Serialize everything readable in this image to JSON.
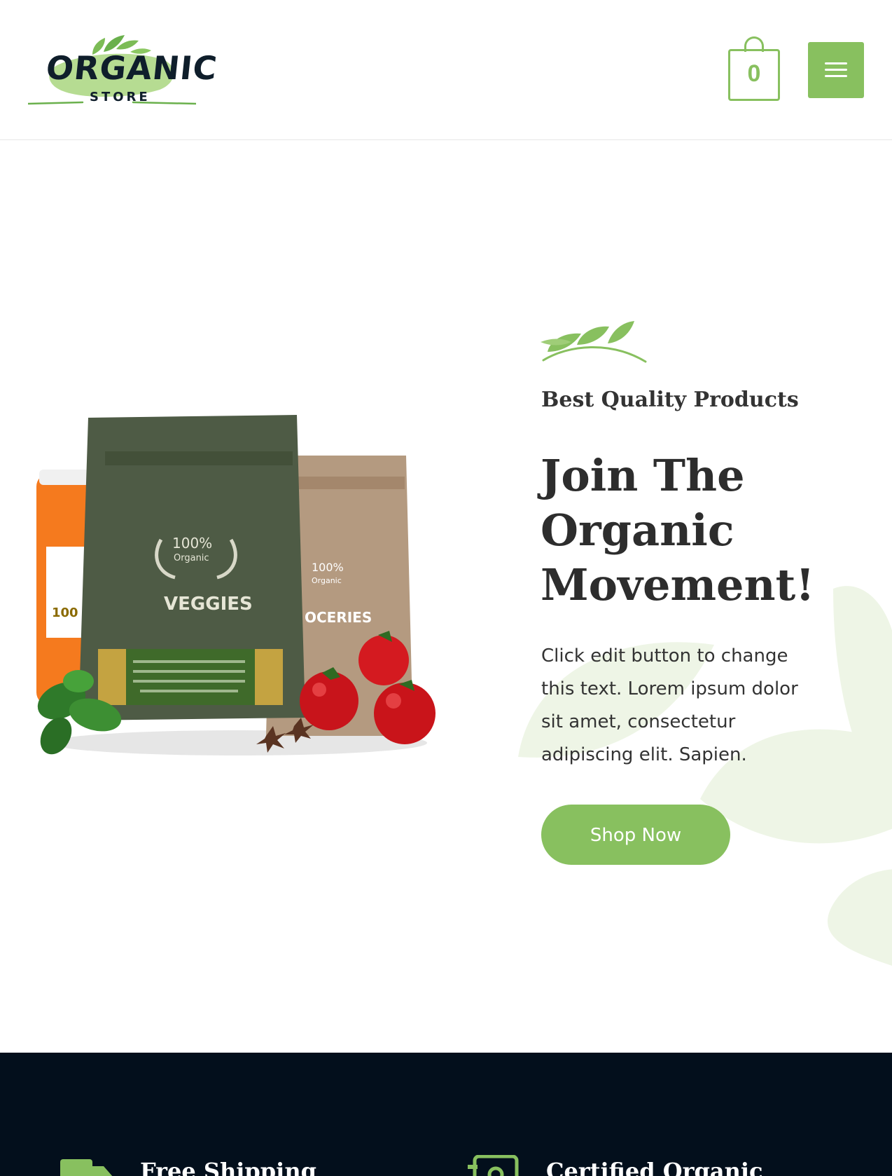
{
  "brand": {
    "logo_word": "ORGANIC",
    "logo_sub": "STORE"
  },
  "header": {
    "cart_count": "0"
  },
  "hero": {
    "eyebrow": "Best Quality Products",
    "title": "Join The Organic Movement!",
    "text": "Click edit button to change this text. Lorem ipsum dolor sit amet, consectetur adipiscing elit. Sapien.",
    "button_label": "Shop Now"
  },
  "products_image": {
    "bag_front_badge": "100%",
    "bag_front_badge_sub": "Organic",
    "bag_front_label": "VEGGIES",
    "bag_back_badge": "100%",
    "bag_back_badge_sub": "Organic",
    "bag_back_label": "OCERIES",
    "jar_label": "100"
  },
  "features": [
    {
      "title": "Free Shipping",
      "icon": "truck-icon"
    },
    {
      "title": "Certified Organic",
      "icon": "certificate-icon"
    }
  ],
  "colors": {
    "accent": "#88c05f",
    "dark": "#030f1c",
    "text": "#333333"
  }
}
